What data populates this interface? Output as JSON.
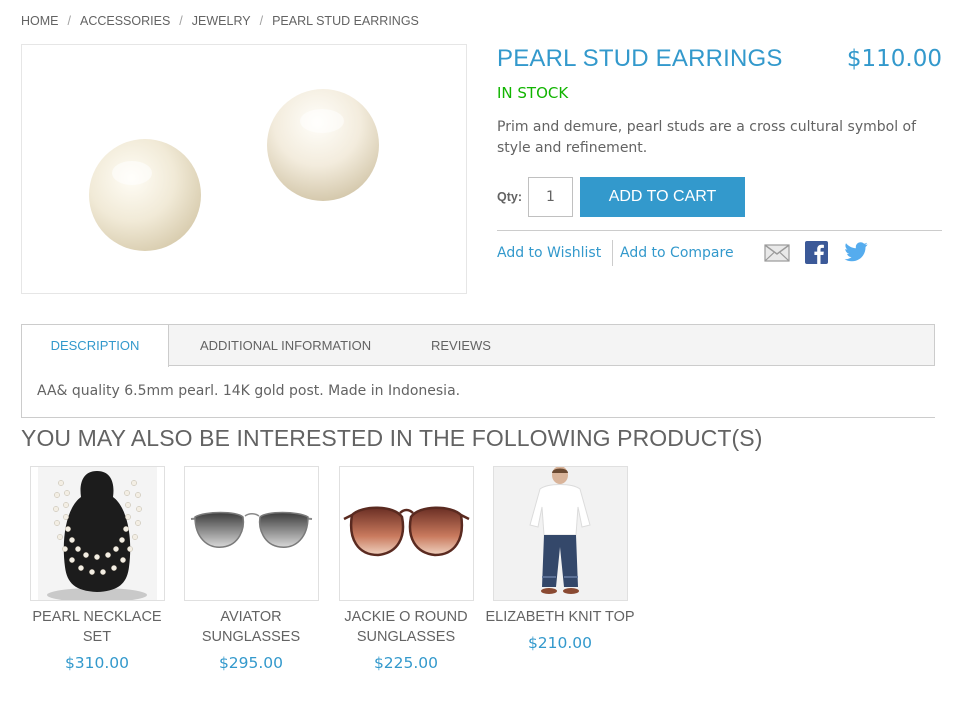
{
  "breadcrumb": {
    "items": [
      "HOME",
      "ACCESSORIES",
      "JEWELRY",
      "PEARL STUD EARRINGS"
    ],
    "separator": "/"
  },
  "product": {
    "name": "PEARL STUD EARRINGS",
    "price": "$110.00",
    "stock": "IN STOCK",
    "short_description": "Prim and demure, pearl studs are a cross cultural symbol of style and refinement.",
    "qty_label": "Qty:",
    "qty_value": "1",
    "add_to_cart_label": "ADD TO CART",
    "wishlist_label": "Add to Wishlist",
    "compare_label": "Add to Compare",
    "share_icons": [
      "email-icon",
      "facebook-icon",
      "twitter-icon"
    ]
  },
  "tabs": {
    "items": [
      "DESCRIPTION",
      "ADDITIONAL INFORMATION",
      "REVIEWS"
    ],
    "active": "DESCRIPTION",
    "content": "AA& quality 6.5mm pearl. 14K gold post. Made in Indonesia."
  },
  "upsell": {
    "title": "YOU MAY ALSO BE INTERESTED IN THE FOLLOWING PRODUCT(S)",
    "products": [
      {
        "name": "PEARL NECKLACE SET",
        "price": "$310.00"
      },
      {
        "name": "AVIATOR SUNGLASSES",
        "price": "$295.00"
      },
      {
        "name": "JACKIE O ROUND SUNGLASSES",
        "price": "$225.00"
      },
      {
        "name": "ELIZABETH KNIT TOP",
        "price": "$210.00"
      }
    ]
  },
  "colors": {
    "accent": "#3399cc",
    "in_stock": "#11b400",
    "text": "#636363",
    "facebook": "#3b5998",
    "twitter": "#55acee"
  }
}
